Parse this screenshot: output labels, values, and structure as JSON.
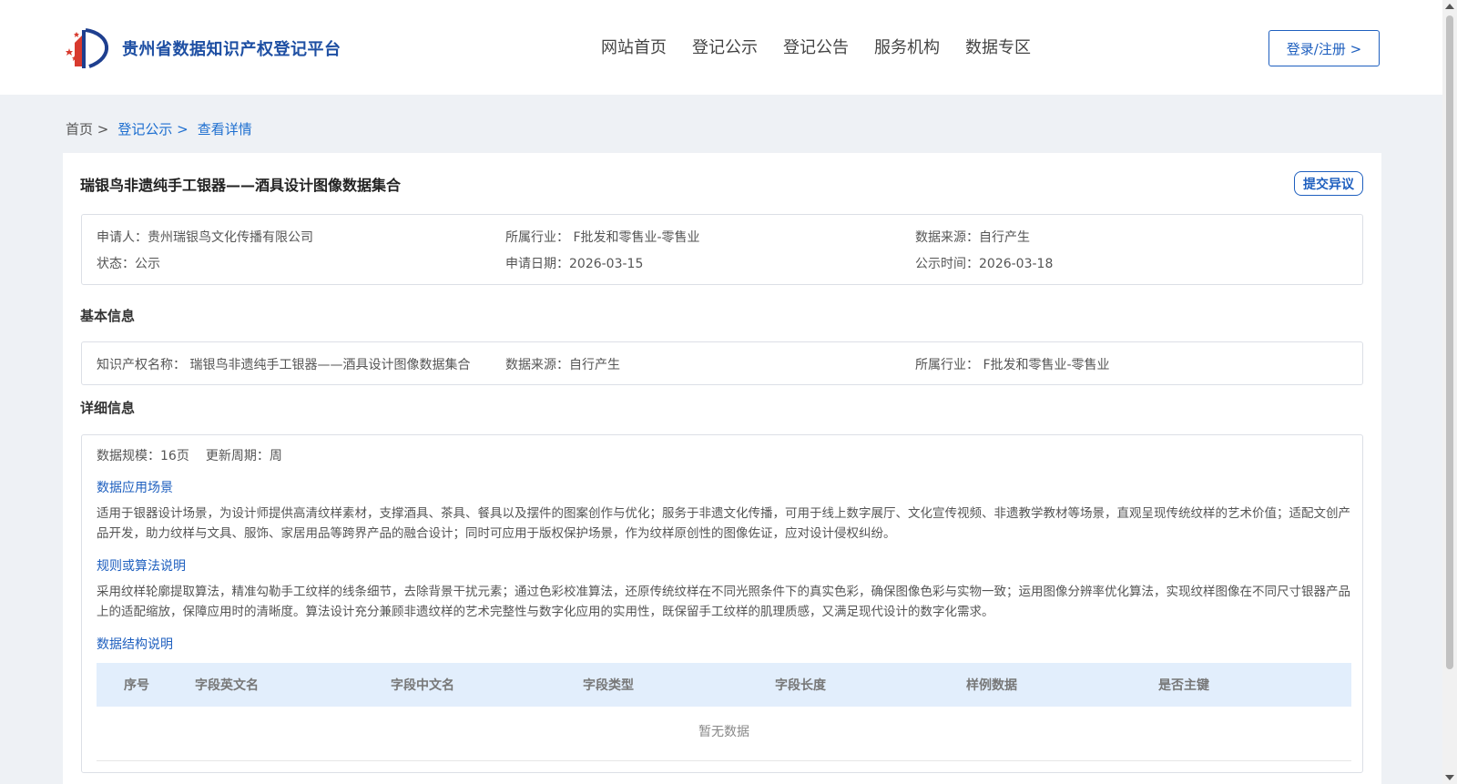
{
  "header": {
    "site_title": "贵州省数据知识产权登记平台",
    "nav": [
      "网站首页",
      "登记公示",
      "登记公告",
      "服务机构",
      "数据专区"
    ],
    "login_label": "登录/注册 >"
  },
  "breadcrumb": [
    "首页 >",
    "登记公示 >",
    "查看详情"
  ],
  "record": {
    "title": "瑞银鸟非遗纯手工银器——酒具设计图像数据集合",
    "objection_label": "提交异议",
    "summary": {
      "applicant": "申请人：贵州瑞银鸟文化传播有限公司",
      "industry": "所属行业： F批发和零售业-零售业",
      "source": "数据来源：自行产生",
      "status": "状态：公示",
      "apply_date": "申请日期：2026-03-15",
      "publish_date": "公示时间：2026-03-18"
    }
  },
  "basic": {
    "heading": "基本信息",
    "name": "知识产权名称： 瑞银鸟非遗纯手工银器——酒具设计图像数据集合",
    "source": "数据来源：自行产生",
    "industry": "所属行业： F批发和零售业-零售业"
  },
  "detail": {
    "heading": "详细信息",
    "scale": "数据规模：16页",
    "cycle": "更新周期：周",
    "scenario_heading": "数据应用场景",
    "scenario_text": "适用于银器设计场景，为设计师提供高清纹样素材，支撑酒具、茶具、餐具以及摆件的图案创作与优化；服务于非遗文化传播，可用于线上数字展厅、文化宣传视频、非遗教学教材等场景，直观呈现传统纹样的艺术价值；适配文创产品开发，助力纹样与文具、服饰、家居用品等跨界产品的融合设计；同时可应用于版权保护场景，作为纹样原创性的图像佐证，应对设计侵权纠纷。",
    "algorithm_heading": "规则或算法说明",
    "algorithm_text": "采用纹样轮廓提取算法，精准勾勒手工纹样的线条细节，去除背景干扰元素；通过色彩校准算法，还原传统纹样在不同光照条件下的真实色彩，确保图像色彩与实物一致；运用图像分辨率优化算法，实现纹样图像在不同尺寸银器产品上的适配缩放，保障应用时的清晰度。算法设计充分兼顾非遗纹样的艺术完整性与数字化应用的实用性，既保留手工纹样的肌理质感，又满足现代设计的数字化需求。",
    "structure_heading": "数据结构说明",
    "table_columns": [
      "序号",
      "字段英文名",
      "字段中文名",
      "字段类型",
      "字段长度",
      "样例数据",
      "是否主键"
    ],
    "empty_text": "暂无数据"
  }
}
